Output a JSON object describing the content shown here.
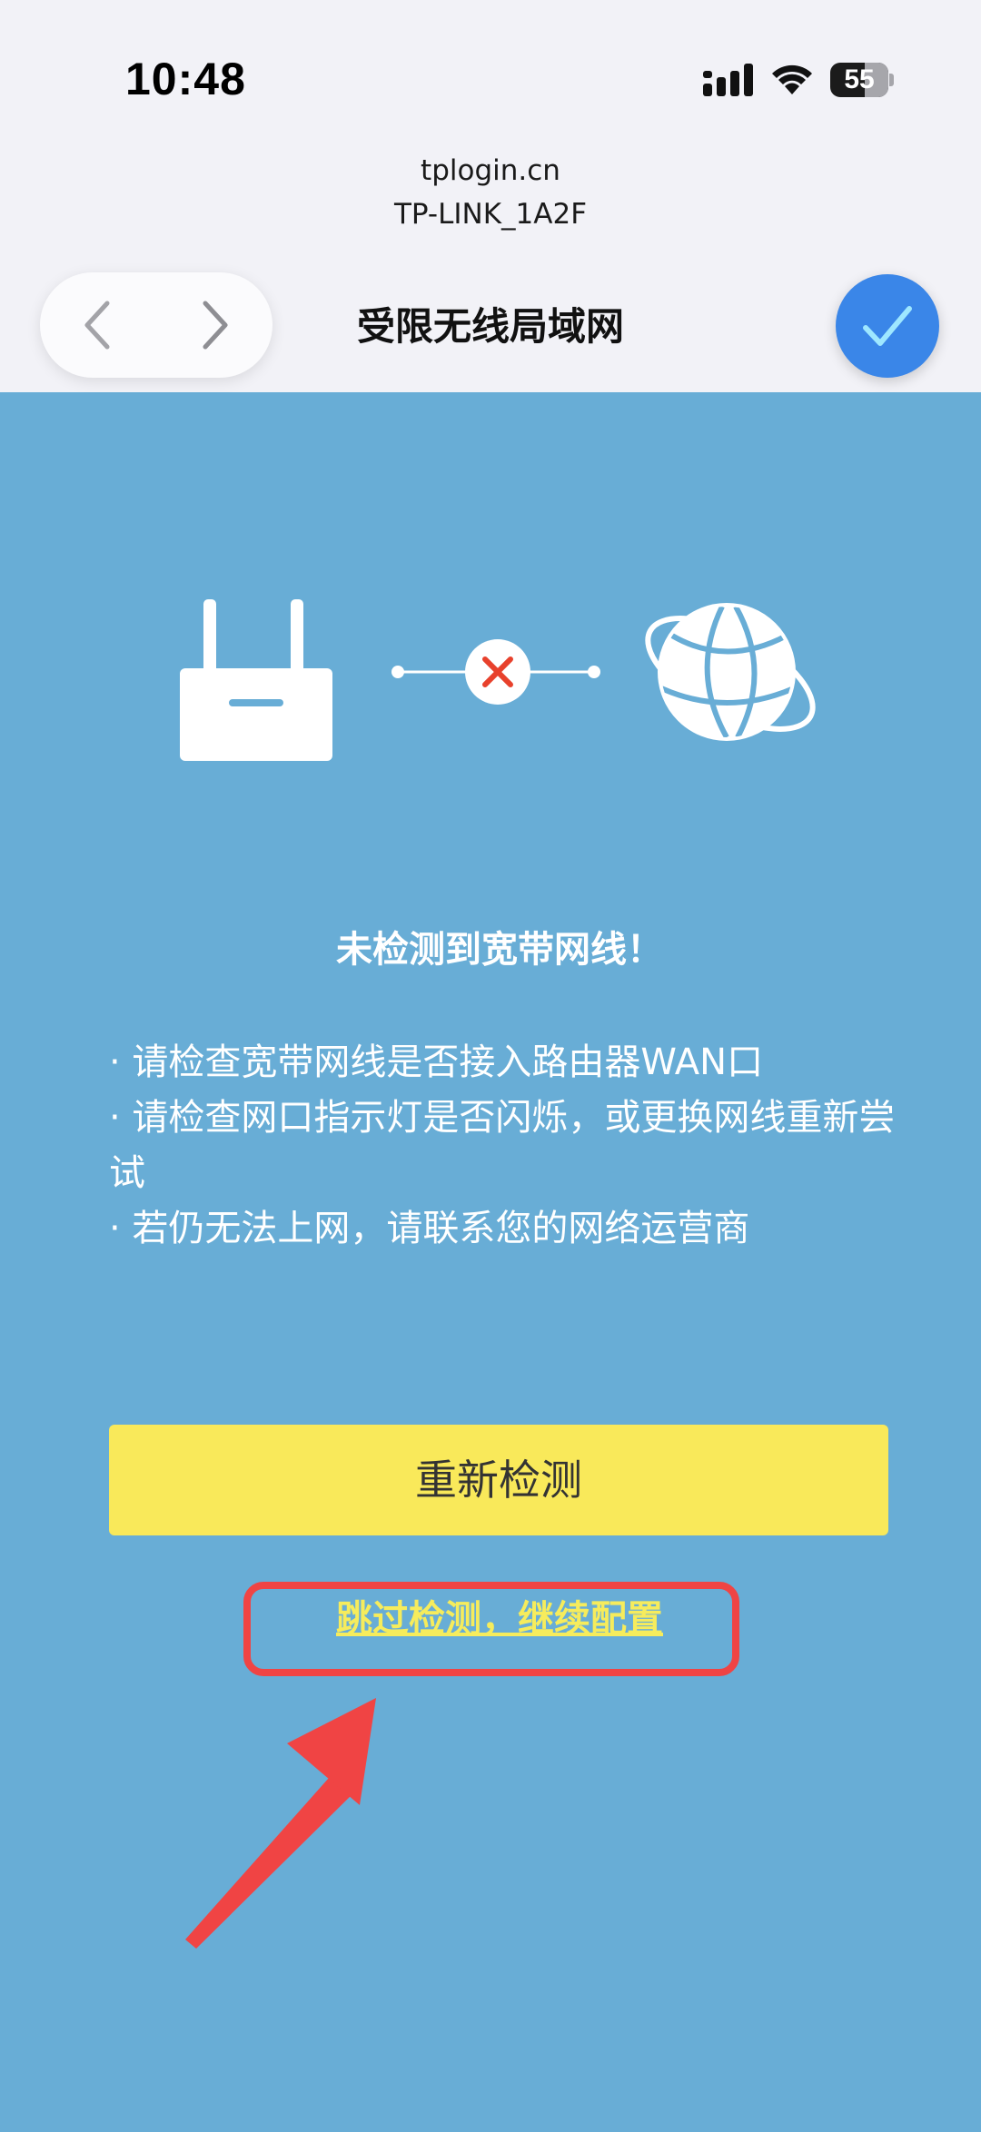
{
  "status_bar": {
    "time": "10:48",
    "battery_level": "55",
    "icons": [
      "signal-icon",
      "wifi-icon",
      "battery-icon"
    ]
  },
  "sheet": {
    "host": "tplogin.cn",
    "ssid": "TP-LINK_1A2F",
    "title": "受限无线局域网"
  },
  "illustration": {
    "icons": [
      "router-icon",
      "disconnected-x-icon",
      "globe-icon"
    ],
    "status": "disconnected"
  },
  "message": {
    "headline": "未检测到宽带网线！",
    "tips": [
      "· 请检查宽带网线是否接入路由器WAN口",
      "· 请检查网口指示灯是否闪烁，或更换网线重新尝试",
      "· 若仍无法上网，请联系您的网络运营商"
    ]
  },
  "actions": {
    "retest_label": "重新检测",
    "skip_label": "跳过检测，继续配置"
  },
  "colors": {
    "background": "#68add6",
    "retest_button": "#f9e95a",
    "skip_link": "#f6ec5c",
    "annotation": "#f04444",
    "confirm_button": "#3a86e8"
  }
}
